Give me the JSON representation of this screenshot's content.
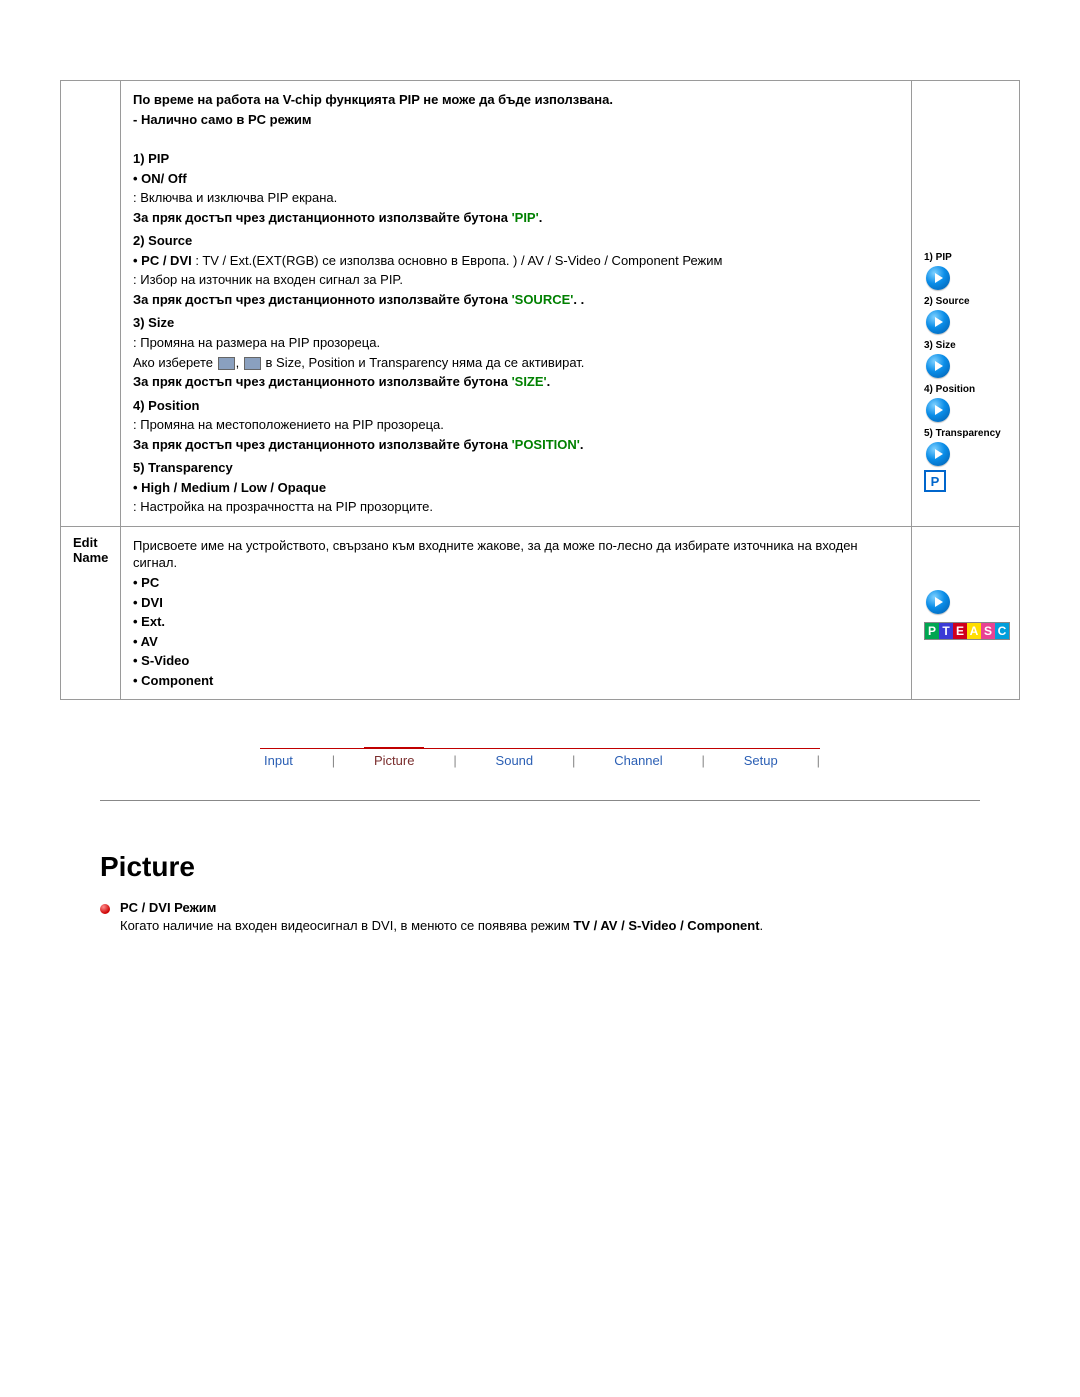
{
  "pip_section": {
    "header_warning": "По време на работа на V-chip функцията PIP не може да бъде използвана.",
    "header_note": "- Налично само в PC режим",
    "items": [
      {
        "num": "1) PIP",
        "bullet": "• ON/ Off",
        "desc": ": Включва и изключва PIP екрана.",
        "direct1": "За пряк достъп чрез дистанционното използвайте бутона ",
        "btn": "'PIP'",
        "direct2": "."
      },
      {
        "num": "2) Source",
        "bullet_bold": "• PC / DVI",
        "bullet_rest": " : TV / Ext.(EXT(RGB) се използва основно в Европа. ) / AV / S-Video / Component Режим",
        "desc": ": Избор на източник на входен сигнал за PIP.",
        "direct1": "За пряк достъп чрез дистанционното използвайте бутона ",
        "btn": "'SOURCE'",
        "direct2": ". ."
      },
      {
        "num": "3) Size",
        "desc": ": Промяна на размера на PIP прозореца.",
        "note_pre": "Ако изберете ",
        "note_mid": " в Size, Position и Transparency няма да се активират.",
        "direct1": "За пряк достъп чрез дистанционното използвайте бутона ",
        "btn": "'SIZE'",
        "direct2": "."
      },
      {
        "num": "4) Position",
        "desc": ": Промяна на местоположението на PIP прозореца.",
        "direct1": "За пряк достъп чрез дистанционното използвайте бутона ",
        "btn": "'POSITION'",
        "direct2": "."
      },
      {
        "num": "5) Transparency",
        "bullet": "• High / Medium / Low / Opaque",
        "desc": ": Настройка на прозрачността на PIP прозорците."
      }
    ],
    "thumbs": [
      "1) PIP",
      "2) Source",
      "3) Size",
      "4) Position",
      "5) Transparency"
    ]
  },
  "edit_name": {
    "label": "Edit Name",
    "intro": "Присвоете име на устройството, свързано към входните жакове, за да може по-лесно да избирате източника на входен сигнал.",
    "options": [
      "• PC",
      "• DVI",
      "• Ext.",
      "• AV",
      "• S-Video",
      "• Component"
    ]
  },
  "nav": {
    "items": [
      "Input",
      "Picture",
      "Sound",
      "Channel",
      "Setup"
    ],
    "active_index": 1
  },
  "picture_section": {
    "title": "Picture",
    "mode_label": "PC / DVI Режим",
    "note_pre": "Когато наличие на входен видеосигнал в DVI, в менюто се появява режим ",
    "note_bold": "TV / AV / S-Video / Component",
    "note_post": "."
  }
}
